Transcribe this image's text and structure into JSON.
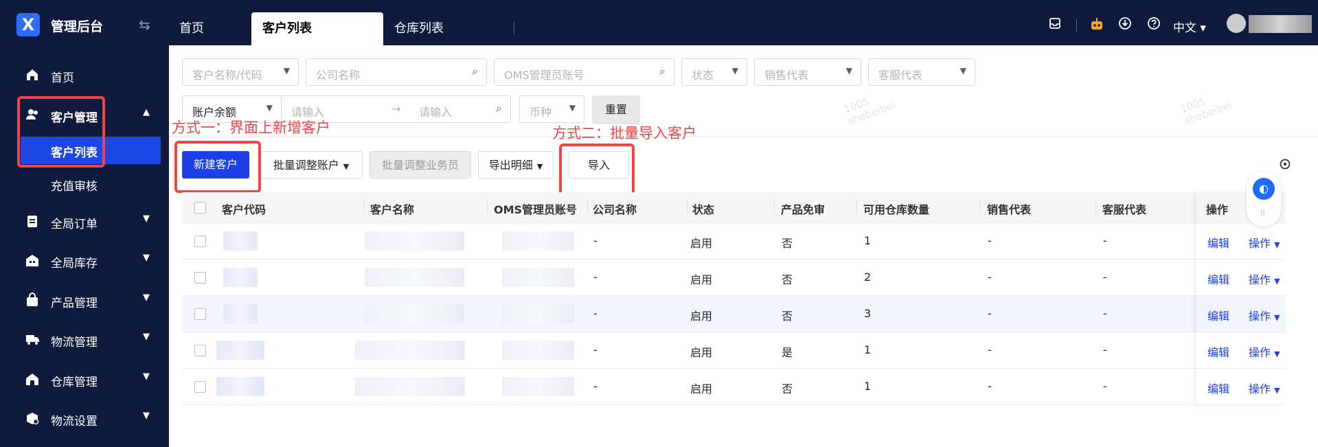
{
  "app": {
    "title": "管理后台",
    "logo_letter": "X"
  },
  "tabs": [
    {
      "label": "首页"
    },
    {
      "label": "客户列表"
    },
    {
      "label": "仓库列表"
    }
  ],
  "header": {
    "lang": "中文"
  },
  "sidebar": {
    "items": [
      {
        "label": "首页",
        "icon": "home-icon"
      },
      {
        "label": "客户管理",
        "icon": "users-icon"
      },
      {
        "label": "客户列表"
      },
      {
        "label": "充值审核"
      },
      {
        "label": "全局订单",
        "icon": "clipboard-icon"
      },
      {
        "label": "全局库存",
        "icon": "warehouse-icon"
      },
      {
        "label": "产品管理",
        "icon": "bag-icon"
      },
      {
        "label": "物流管理",
        "icon": "truck-icon"
      },
      {
        "label": "仓库管理",
        "icon": "house-icon"
      },
      {
        "label": "物流设置",
        "icon": "box-gear-icon"
      }
    ]
  },
  "filters": {
    "customer_name_code": "客户名称/代码",
    "company_name": "公司名称",
    "oms_account": "OMS管理员账号",
    "status": "状态",
    "sales_rep": "销售代表",
    "service_rep": "客服代表",
    "balance_type": "账户余额",
    "min_placeholder": "请输入",
    "max_placeholder": "请输入",
    "currency": "币种",
    "reset_label": "重置"
  },
  "toolbar": {
    "new_customer": "新建客户",
    "batch_adjust_account": "批量调整账户",
    "batch_adjust_staff": "批量调整业务员",
    "export_detail": "导出明细",
    "import": "导入"
  },
  "annotations": {
    "method1": "方式一：界面上新增客户",
    "method2": "方式二：批量导入客户"
  },
  "watermark": {
    "line1": "1005",
    "line2": "shebeibei"
  },
  "table": {
    "columns": {
      "code": "客户代码",
      "name": "客户名称",
      "oms": "OMS管理员账号",
      "company": "公司名称",
      "status": "状态",
      "exempt": "产品免审",
      "warehouses": "可用仓库数量",
      "sales": "销售代表",
      "service": "客服代表",
      "ops": "操作"
    },
    "edit_label": "编辑",
    "ops_label": "操作",
    "rows": [
      {
        "company": "-",
        "status": "启用",
        "exempt": "否",
        "warehouses": "1",
        "sales": "-",
        "service": "-"
      },
      {
        "company": "-",
        "status": "启用",
        "exempt": "否",
        "warehouses": "2",
        "sales": "-",
        "service": "-"
      },
      {
        "company": "-",
        "status": "启用",
        "exempt": "否",
        "warehouses": "3",
        "sales": "-",
        "service": "-"
      },
      {
        "company": "-",
        "status": "启用",
        "exempt": "是",
        "warehouses": "1",
        "sales": "-",
        "service": "-"
      },
      {
        "company": "-",
        "status": "启用",
        "exempt": "否",
        "warehouses": "1",
        "sales": "-",
        "service": "-"
      }
    ]
  }
}
